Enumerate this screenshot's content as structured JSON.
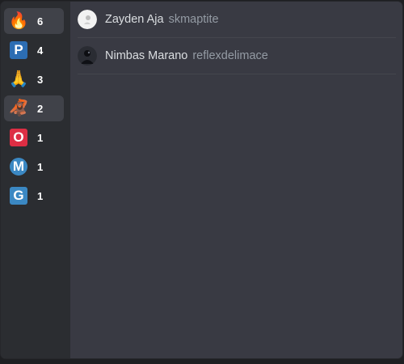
{
  "reactions": [
    {
      "icon": "fire-emoji",
      "glyph": "🔥",
      "count": "6"
    },
    {
      "icon": "p-letter-icon",
      "letter": "P",
      "color": "#2c6db3",
      "count": "4"
    },
    {
      "icon": "praying-hands-emoji",
      "glyph": "🙏",
      "count": "3"
    },
    {
      "icon": "orangutan-emoji",
      "glyph": "🦧",
      "count": "2"
    },
    {
      "icon": "o-letter-icon",
      "letter": "O",
      "color": "#dd2e44",
      "count": "1"
    },
    {
      "icon": "m-circle-icon",
      "letter": "M",
      "color": "#3b88c3",
      "count": "1"
    },
    {
      "icon": "g-letter-icon",
      "letter": "G",
      "color": "#3b88c3",
      "count": "1"
    }
  ],
  "users": [
    {
      "display_name": "Zayden Aja",
      "username": "skmaptite",
      "avatar": "white-avatar"
    },
    {
      "display_name": "Nimbas Marano",
      "username": "reflexdelimace",
      "avatar": "dark-avatar"
    }
  ]
}
